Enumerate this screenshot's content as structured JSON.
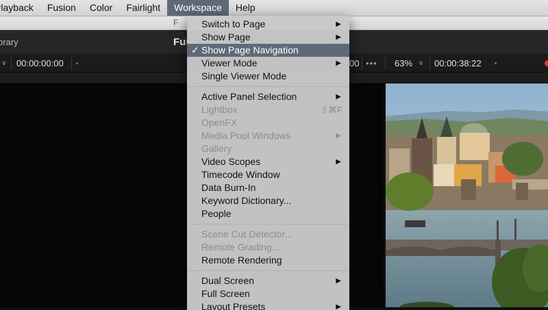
{
  "menubar": {
    "items": [
      "Playback",
      "Fusion",
      "Color",
      "Fairlight",
      "Workspace",
      "Help"
    ],
    "active": "Workspace"
  },
  "titlebar": {
    "title": "F"
  },
  "tabs": {
    "library": "brary",
    "page": "Fus"
  },
  "toolbar": {
    "timecode_left": "00:00:00:00",
    "timecode_mid": "00",
    "dots": "•••",
    "zoom": "63%",
    "timecode_right": "00:00:38:22"
  },
  "menu": {
    "groups": [
      [
        {
          "label": "Switch to Page",
          "submenu": true
        },
        {
          "label": "Show Page",
          "submenu": true
        },
        {
          "label": "Show Page Navigation",
          "checked": true,
          "highlighted": true
        },
        {
          "label": "Viewer Mode",
          "submenu": true
        },
        {
          "label": "Single Viewer Mode"
        }
      ],
      [
        {
          "label": "Active Panel Selection",
          "submenu": true
        },
        {
          "label": "Lightbox",
          "disabled": true,
          "shortcut": "⇧⌘F"
        },
        {
          "label": "OpenFX",
          "disabled": true
        },
        {
          "label": "Media Pool Windows",
          "disabled": true,
          "submenu": true
        },
        {
          "label": "Gallery",
          "disabled": true
        },
        {
          "label": "Video Scopes",
          "submenu": true
        },
        {
          "label": "Timecode Window"
        },
        {
          "label": "Data Burn-In"
        },
        {
          "label": "Keyword Dictionary..."
        },
        {
          "label": "People"
        }
      ],
      [
        {
          "label": "Scene Cut Detector...",
          "disabled": true
        },
        {
          "label": "Remote Grading...",
          "disabled": true
        },
        {
          "label": "Remote Rendering"
        }
      ],
      [
        {
          "label": "Dual Screen",
          "submenu": true
        },
        {
          "label": "Full Screen"
        },
        {
          "label": "Layout Presets",
          "submenu": true
        }
      ]
    ],
    "check_glyph": "✓",
    "arrow_glyph": "▶"
  },
  "colors": {
    "highlight": "#5f6a78",
    "menu_bg": "#c8c8c8",
    "record_dot": "#e0372a"
  }
}
